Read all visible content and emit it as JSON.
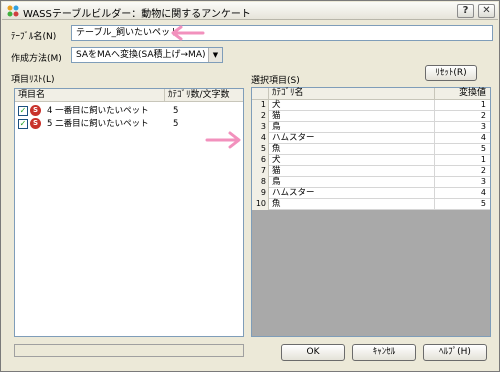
{
  "window": {
    "title": "WASSテーブルビルダー：動物に関するアンケート",
    "help_glyph": "?",
    "close_glyph": "✕",
    "app_icon": "wass-app-icon"
  },
  "form": {
    "table_name_label": "ﾃｰﾌﾞﾙ名(N)",
    "table_name_value": "テーブル_飼いたいペット",
    "method_label": "作成方法(M)",
    "method_value": "SAをMAへ変換(SA積上げ→MA)",
    "dropdown_glyph": "▼"
  },
  "item_list": {
    "label": "項目ﾘｽﾄ(L)",
    "columns": [
      "項目名",
      "ｶﾃｺﾞﾘ数/文字数"
    ],
    "check_glyph": "✓",
    "icon_glyph": "S",
    "rows": [
      {
        "text": "4 一番目に飼いたいペット",
        "count": "5"
      },
      {
        "text": "5 二番目に飼いたいペット",
        "count": "5"
      }
    ]
  },
  "selected": {
    "label": "選択項目(S)",
    "reset_label": "ﾘｾｯﾄ(R)",
    "columns": [
      "ｶﾃｺﾞﾘ名",
      "変換値"
    ],
    "rows": [
      {
        "n": "1",
        "cat": "犬",
        "val": "1"
      },
      {
        "n": "2",
        "cat": "猫",
        "val": "2"
      },
      {
        "n": "3",
        "cat": "鳥",
        "val": "3"
      },
      {
        "n": "4",
        "cat": "ハムスター",
        "val": "4"
      },
      {
        "n": "5",
        "cat": "魚",
        "val": "5"
      },
      {
        "n": "6",
        "cat": "犬",
        "val": "1"
      },
      {
        "n": "7",
        "cat": "猫",
        "val": "2"
      },
      {
        "n": "8",
        "cat": "鳥",
        "val": "3"
      },
      {
        "n": "9",
        "cat": "ハムスター",
        "val": "4"
      },
      {
        "n": "10",
        "cat": "魚",
        "val": "5"
      }
    ]
  },
  "buttons": {
    "ok": "OK",
    "cancel": "ｷｬﾝｾﾙ",
    "help": "ﾍﾙﾌﾟ(H)"
  },
  "colors": {
    "annotation_arrow": "#f291bd",
    "dialog_bg": "#ece9d8",
    "empty_area": "#a9a9a9"
  }
}
